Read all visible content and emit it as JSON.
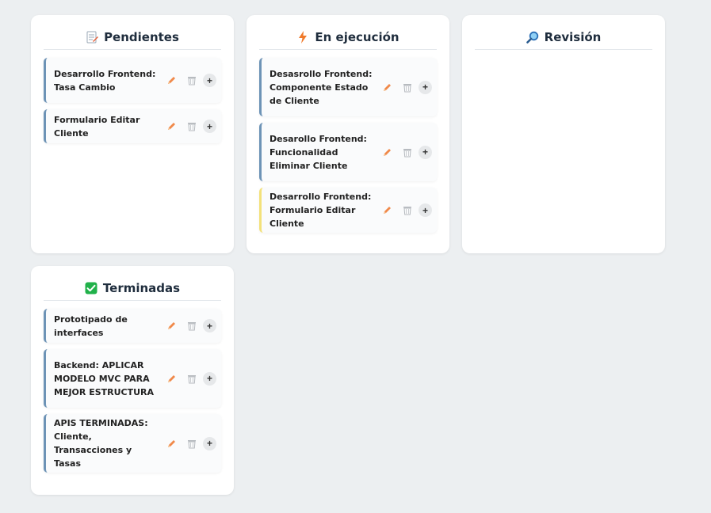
{
  "columns": [
    {
      "title": "Pendientes",
      "icon": "memo-icon",
      "cards": [
        {
          "text": "Desarrollo Frontend: Tasa Cambio",
          "accent": "#6d93b6"
        },
        {
          "text": "Formulario Editar Cliente",
          "accent": "#6d93b6"
        }
      ]
    },
    {
      "title": "En ejecución",
      "icon": "lightning-icon",
      "cards": [
        {
          "text": "Desasrollo Frontend: Componente Estado de Cliente",
          "accent": "#6d93b6"
        },
        {
          "text": "Desarollo Frontend: Funcionalidad Eliminar Cliente",
          "accent": "#6d93b6"
        },
        {
          "text": "Desarrollo Frontend: Formulario Editar Cliente",
          "accent": "#f3e17a"
        }
      ]
    },
    {
      "title": "Revisión",
      "icon": "magnifier-icon",
      "cards": []
    },
    {
      "title": "Terminadas",
      "icon": "checkmark-icon",
      "cards": [
        {
          "text": "Prototipado de interfaces",
          "accent": "#6d93b6"
        },
        {
          "text": "Backend: APLICAR MODELO MVC PARA MEJOR ESTRUCTURA",
          "accent": "#6d93b6"
        },
        {
          "text": "APIS TERMINADAS: Cliente, Transacciones y Tasas",
          "accent": "#6d93b6"
        }
      ]
    }
  ],
  "actions": {
    "edit_icon": "pencil-icon",
    "delete_icon": "trash-icon",
    "add_label": "+"
  },
  "colors": {
    "background": "#eceff1",
    "card_accent": "#6d93b6",
    "highlight_accent": "#f3e17a",
    "pencil": "#f0894a",
    "check": "#21b14a"
  }
}
